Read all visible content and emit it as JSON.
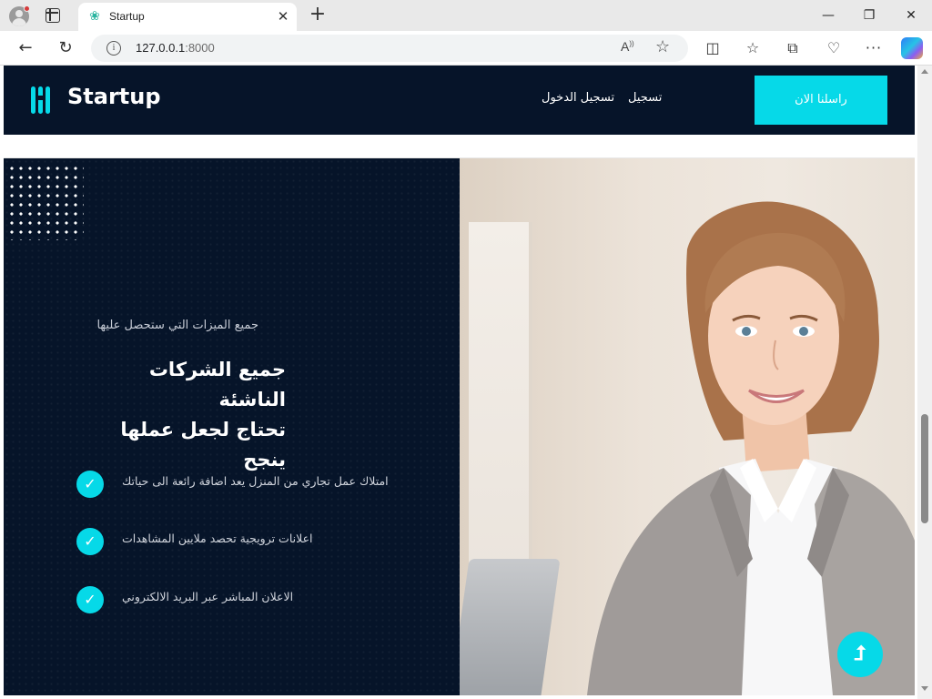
{
  "browser": {
    "tab_title": "Startup",
    "url_host": "127.0.0.1",
    "url_port": ":8000",
    "read_aloud_label": "A",
    "icons": {
      "profile": "profile-avatar-icon",
      "tab_actions": "tab-actions-icon",
      "favicon": "favicon-icon",
      "close": "close-icon",
      "new_tab": "plus-icon",
      "back": "back-arrow-icon",
      "reload": "reload-icon",
      "info": "info-icon",
      "star": "star-icon",
      "split": "split-screen-icon",
      "favorites": "favorites-icon",
      "collections": "collections-icon",
      "performance": "browser-essentials-icon",
      "more": "more-icon",
      "copilot": "copilot-icon"
    }
  },
  "nav": {
    "logo_text": "Startup",
    "links": [
      {
        "label": "تسجيل الدخول"
      },
      {
        "label": "تسجيل"
      }
    ],
    "cta_label": "راسلنا الان"
  },
  "hero": {
    "subtitle": "جميع الميزات التي ستحصل عليها",
    "title_line1": "جميع الشركات الناشئة",
    "title_line2": "تحتاج لجعل عملها ينجح",
    "features": [
      {
        "text": "امتلاك عمل تجاري من المنزل يعد اضافة رائعة الى حياتك"
      },
      {
        "text": "اعلانات ترويجية تحصد ملايين المشاهدات"
      },
      {
        "text": "الاعلان المباشر عبر البريد الالكتروني"
      }
    ],
    "check_glyph": "✓"
  },
  "scroll_top_glyph": "⮥",
  "colors": {
    "navy": "#061429",
    "accent": "#06d9e8"
  }
}
